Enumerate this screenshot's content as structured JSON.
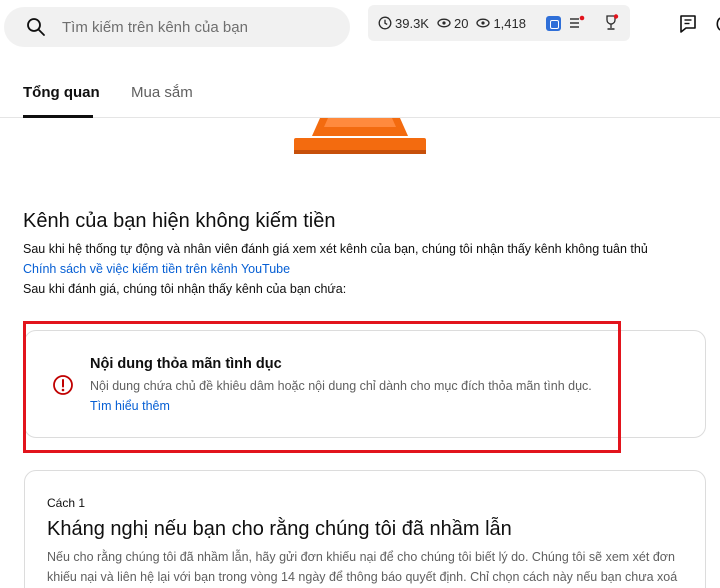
{
  "search": {
    "placeholder": "Tìm kiếm trên kênh của bạn"
  },
  "stats": {
    "hours": "39.3K",
    "subscribers": "20",
    "views": "1,418"
  },
  "tabs": [
    {
      "label": "Tổng quan",
      "active": true
    },
    {
      "label": "Mua sắm",
      "active": false
    }
  ],
  "status": {
    "headline": "Kênh của bạn hiện không kiếm tiền",
    "description": "Sau khi hệ thống tự động và nhân viên đánh giá xem xét kênh của bạn, chúng tôi nhận thấy kênh không tuân thủ",
    "policy_link": "Chính sách về việc kiếm tiền trên kênh YouTube",
    "after_review": "Sau khi đánh giá, chúng tôi nhận thấy kênh của bạn chứa:"
  },
  "violation": {
    "title": "Nội dung thỏa mãn tình dục",
    "description": "Nội dung chứa chủ đề khiêu dâm hoặc nội dung chỉ dành cho mục đích thỏa mãn tình dục.",
    "learn_more": "Tìm hiểu thêm"
  },
  "option": {
    "label": "Cách 1",
    "title": "Kháng nghị nếu bạn cho rằng chúng tôi đã nhầm lẫn",
    "description_line1": "Nếu cho rằng chúng tôi đã nhầm lẫn, hãy gửi đơn khiếu nại để cho chúng tôi biết lý do. Chúng tôi sẽ xem xét đơn",
    "description_line2": "khiếu nại và liên hệ lại với bạn trong vòng 14 ngày để thông báo quyết định. Chỉ chọn cách này nếu bạn chưa xoá"
  },
  "colors": {
    "accent_link": "#065fd4",
    "highlight_box": "#e2141d",
    "warning": "#c00000",
    "cone": "#f36b0f"
  },
  "icons": [
    "search-icon",
    "clock-icon",
    "subscribers-icon",
    "views-icon",
    "extension-icon",
    "list-icon",
    "trophy-icon",
    "feedback-icon",
    "warning-icon"
  ]
}
